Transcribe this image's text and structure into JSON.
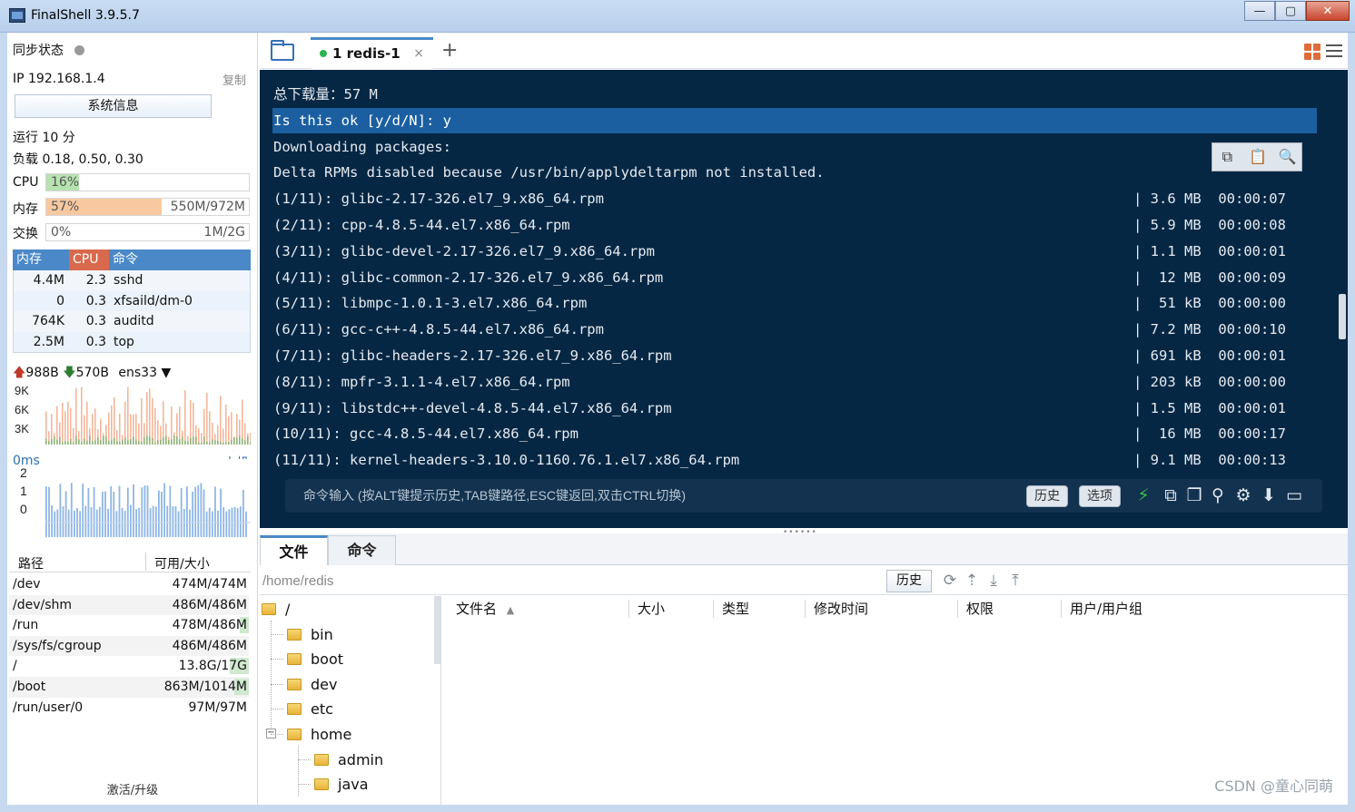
{
  "window": {
    "title": "FinalShell 3.9.5.7",
    "buttons": [
      "—",
      "▢",
      "✕"
    ]
  },
  "sidebar": {
    "sync_label": "同步状态",
    "ip_label": "IP 192.168.1.4",
    "copy_label": "复制",
    "sysinfo_button": "系统信息",
    "uptime": "运行 10 分",
    "load": "负载 0.18, 0.50, 0.30",
    "meters": {
      "cpu": {
        "label": "CPU",
        "percent_text": "16%",
        "fraction": 0.16,
        "value": "",
        "color": "#b7e2b1"
      },
      "mem": {
        "label": "内存",
        "percent_text": "57%",
        "fraction": 0.57,
        "value": "550M/972M",
        "color": "#f8c9a0"
      },
      "swap": {
        "label": "交换",
        "percent_text": "0%",
        "fraction": 0.0,
        "value": "1M/2G",
        "color": "#d9d9d9"
      }
    },
    "process_table": {
      "headers": {
        "mem": "内存",
        "cpu": "CPU",
        "cmd": "命令"
      },
      "header_colors": {
        "mem": "#4a88c8",
        "cpu": "#d9694c",
        "cmd": "#4a88c8"
      },
      "rows": [
        {
          "mem": "4.4M",
          "cpu": "2.3",
          "cmd": "sshd"
        },
        {
          "mem": "0",
          "cpu": "0.3",
          "cmd": "xfsaild/dm-0"
        },
        {
          "mem": "764K",
          "cpu": "0.3",
          "cmd": "auditd"
        },
        {
          "mem": "2.5M",
          "cpu": "0.3",
          "cmd": "top"
        }
      ]
    },
    "network": {
      "up": "988B",
      "down": "570B",
      "interface": "ens33",
      "y_labels": [
        "9K",
        "6K",
        "3K"
      ]
    },
    "latency": {
      "ms_label": "0ms",
      "host_label": "本机",
      "y_labels": [
        "2",
        "1",
        "0"
      ]
    },
    "filesystem": {
      "headers": {
        "path": "路径",
        "size": "可用/大小"
      },
      "rows": [
        {
          "path": "/dev",
          "size": "474M/474M",
          "used": 0.0
        },
        {
          "path": "/dev/shm",
          "size": "486M/486M",
          "used": 0.0
        },
        {
          "path": "/run",
          "size": "478M/486M",
          "used": 0.02
        },
        {
          "path": "/sys/fs/cgroup",
          "size": "486M/486M",
          "used": 0.0
        },
        {
          "path": "/",
          "size": "13.8G/17G",
          "used": 0.19
        },
        {
          "path": "/boot",
          "size": "863M/1014M",
          "used": 0.15
        },
        {
          "path": "/run/user/0",
          "size": "97M/97M",
          "used": 0.0
        }
      ]
    },
    "activate_label": "激活/升级"
  },
  "tabs": {
    "session_tab": "1 redis-1",
    "close_symbol": "×",
    "add_symbol": "+"
  },
  "terminal": {
    "lines": [
      {
        "text": "总下载量：57 M",
        "right": ""
      },
      {
        "text": "Is this ok [y/d/N]: y",
        "right": "",
        "highlight": true
      },
      {
        "text": "Downloading packages:",
        "right": ""
      },
      {
        "text": "Delta RPMs disabled because /usr/bin/applydeltarpm not installed.",
        "right": ""
      },
      {
        "text": "(1/11): glibc-2.17-326.el7_9.x86_64.rpm",
        "right": "| 3.6 MB  00:00:07"
      },
      {
        "text": "(2/11): cpp-4.8.5-44.el7.x86_64.rpm",
        "right": "| 5.9 MB  00:00:08"
      },
      {
        "text": "(3/11): glibc-devel-2.17-326.el7_9.x86_64.rpm",
        "right": "| 1.1 MB  00:00:01"
      },
      {
        "text": "(4/11): glibc-common-2.17-326.el7_9.x86_64.rpm",
        "right": "|  12 MB  00:00:09"
      },
      {
        "text": "(5/11): libmpc-1.0.1-3.el7.x86_64.rpm",
        "right": "|  51 kB  00:00:00"
      },
      {
        "text": "(6/11): gcc-c++-4.8.5-44.el7.x86_64.rpm",
        "right": "| 7.2 MB  00:00:10"
      },
      {
        "text": "(7/11): glibc-headers-2.17-326.el7_9.x86_64.rpm",
        "right": "| 691 kB  00:00:01"
      },
      {
        "text": "(8/11): mpfr-3.1.1-4.el7.x86_64.rpm",
        "right": "| 203 kB  00:00:00"
      },
      {
        "text": "(9/11): libstdc++-devel-4.8.5-44.el7.x86_64.rpm",
        "right": "| 1.5 MB  00:00:01"
      },
      {
        "text": "(10/11): gcc-4.8.5-44.el7.x86_64.rpm",
        "right": "|  16 MB  00:00:17"
      },
      {
        "text": "(11/11): kernel-headers-3.10.0-1160.76.1.el7.x86_64.rpm",
        "right": "| 9.1 MB  00:00:13"
      }
    ],
    "command_placeholder": "命令输入 (按ALT键提示历史,TAB键路径,ESC键返回,双击CTRL切换)",
    "history_button": "历史",
    "options_button": "选项"
  },
  "bottom": {
    "tab_files": "文件",
    "tab_commands": "命令",
    "path_value": "/home/redis",
    "history_button": "历史",
    "tree": [
      {
        "name": "/",
        "level": 0
      },
      {
        "name": "bin",
        "level": 1
      },
      {
        "name": "boot",
        "level": 1
      },
      {
        "name": "dev",
        "level": 1
      },
      {
        "name": "etc",
        "level": 1
      },
      {
        "name": "home",
        "level": 1
      },
      {
        "name": "admin",
        "level": 2
      },
      {
        "name": "java",
        "level": 2
      }
    ],
    "expander_symbol": "−",
    "columns": [
      "文件名",
      "大小",
      "类型",
      "修改时间",
      "权限",
      "用户/用户组"
    ],
    "sort_symbol": "▲"
  },
  "watermark": "CSDN @童心同萌"
}
